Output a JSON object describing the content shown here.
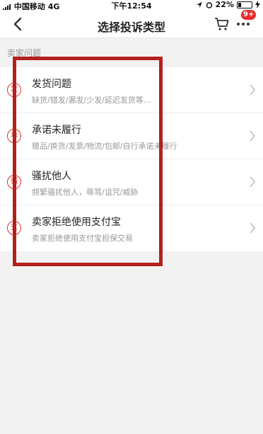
{
  "status_bar": {
    "carrier": "中国移动",
    "network": "4G",
    "time": "下午12:54",
    "battery": "22%",
    "battery_level": 0.22
  },
  "nav": {
    "title": "选择投诉类型",
    "badge": "9+"
  },
  "section_label": "卖家问题",
  "items": [
    {
      "title": "发货问题",
      "subtitle": "缺货/错发/漏发/少发/延迟发货等...",
      "icon_char": "发",
      "icon": "circle-badge-icon"
    },
    {
      "title": "承诺未履行",
      "subtitle": "赠品/换货/发票/物流/包邮/自行承诺未履行",
      "icon_char": "承",
      "icon": "circle-badge-icon"
    },
    {
      "title": "骚扰他人",
      "subtitle": "频繁骚扰他人，辱骂/诅咒/威胁",
      "icon_char": "骚",
      "icon": "circle-badge-icon"
    },
    {
      "title": "卖家拒绝使用支付宝",
      "subtitle": "卖家拒绝使用支付宝担保交易",
      "icon_char": "支",
      "icon": "circle-badge-icon"
    }
  ],
  "colors": {
    "accent": "#e0302e",
    "badge": "#e42b2b",
    "highlight": "#b3201c"
  }
}
